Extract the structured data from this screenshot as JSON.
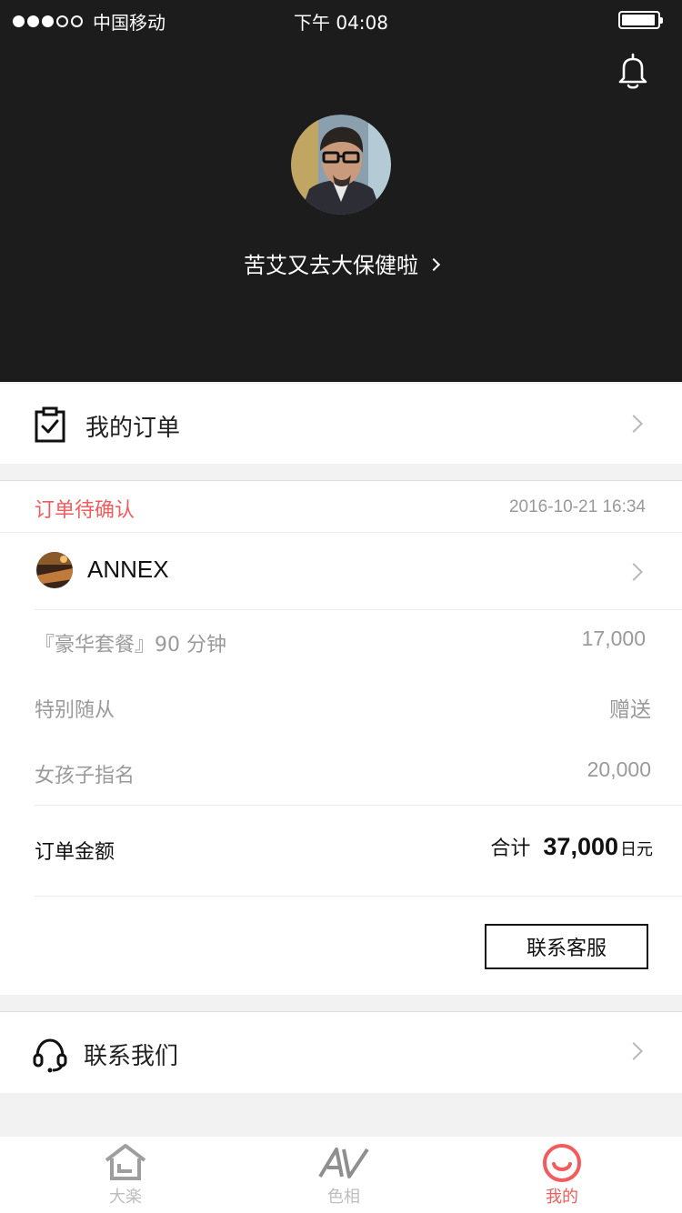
{
  "status_bar": {
    "carrier": "中国移动",
    "time": "下午 04:08"
  },
  "profile": {
    "username": "苦艾又去大保健啦"
  },
  "my_orders": {
    "label": "我的订单"
  },
  "order": {
    "status": "订单待确认",
    "datetime": "2016-10-21 16:34",
    "shop_name": "ANNEX",
    "items": [
      {
        "name": "『豪华套餐』90 分钟",
        "value": "17,000"
      },
      {
        "name": "特别随从",
        "value": "赠送"
      },
      {
        "name": "女孩子指名",
        "value": "20,000"
      }
    ],
    "total_label": "订单金额",
    "total_prefix": "合计",
    "total_amount": "37,000",
    "total_unit": "日元",
    "service_button": "联系客服"
  },
  "contact": {
    "label": "联系我们"
  },
  "tabbar": {
    "tabs": [
      {
        "label": "大楽",
        "icon": "home-icon"
      },
      {
        "label": "色相",
        "icon": "av-icon"
      },
      {
        "label": "我的",
        "icon": "smile-icon"
      }
    ],
    "active_color": "#f25c5c",
    "inactive_color": "#bdbdbd"
  },
  "colors": {
    "header_bg": "#1c1c1c",
    "accent": "#f25c5c"
  }
}
